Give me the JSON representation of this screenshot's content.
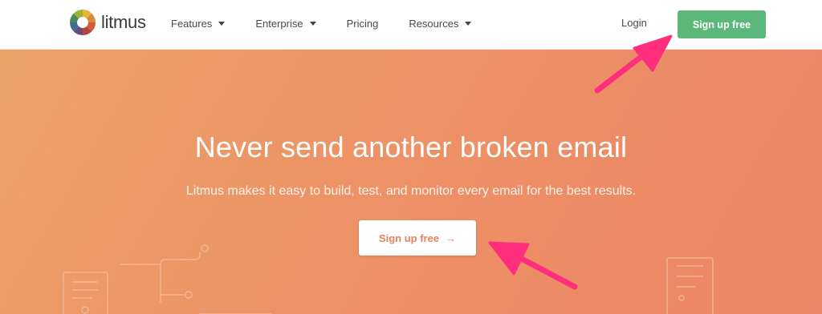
{
  "brand": {
    "name": "litmus"
  },
  "nav": {
    "items": [
      {
        "label": "Features",
        "has_dropdown": true
      },
      {
        "label": "Enterprise",
        "has_dropdown": true
      },
      {
        "label": "Pricing",
        "has_dropdown": false
      },
      {
        "label": "Resources",
        "has_dropdown": true
      }
    ],
    "login": "Login",
    "signup": "Sign up free"
  },
  "hero": {
    "title": "Never send another broken email",
    "subtitle": "Litmus makes it easy to build, test, and monitor every email for the best results.",
    "cta_label": "Sign up free",
    "cta_arrow": "→"
  },
  "colors": {
    "header_bg": "#ffffff",
    "primary_green": "#5cb87a",
    "hero_gradient_start": "#eba368",
    "hero_gradient_end": "#ec8567",
    "cta_text": "#e8805a",
    "annotation_arrow": "#ff2f7d"
  },
  "icons": {
    "logo": "litmus-wheel-icon",
    "dropdown": "caret-down-icon",
    "cta": "arrow-right-icon",
    "annotation": "pink-pointer-arrow"
  }
}
